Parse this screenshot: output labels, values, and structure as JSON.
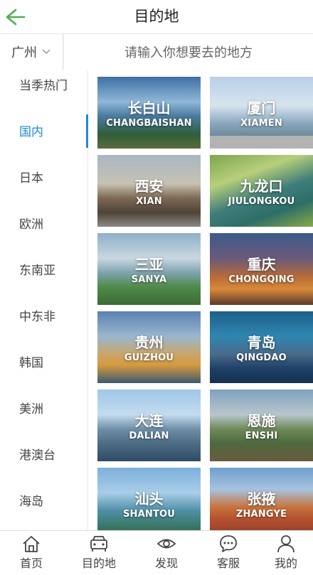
{
  "header": {
    "title": "目的地"
  },
  "search": {
    "city": "广州",
    "placeholder": "请输入你想要去的地方"
  },
  "sidebar": {
    "items": [
      "当季热门",
      "国内",
      "日本",
      "欧洲",
      "东南亚",
      "中东非",
      "韩国",
      "美洲",
      "港澳台",
      "海岛"
    ],
    "active": "国内"
  },
  "destinations": [
    {
      "cn": "长白山",
      "en": "CHANGBAISHAN"
    },
    {
      "cn": "厦门",
      "en": "XIAMEN"
    },
    {
      "cn": "西安",
      "en": "XIAN"
    },
    {
      "cn": "九龙口",
      "en": "JIULONGKOU"
    },
    {
      "cn": "三亚",
      "en": "SANYA"
    },
    {
      "cn": "重庆",
      "en": "CHONGQING"
    },
    {
      "cn": "贵州",
      "en": "GUIZHOU"
    },
    {
      "cn": "青岛",
      "en": "QINGDAO"
    },
    {
      "cn": "大连",
      "en": "DALIAN"
    },
    {
      "cn": "恩施",
      "en": "ENSHI"
    },
    {
      "cn": "汕头",
      "en": "SHANTOU"
    },
    {
      "cn": "张掖",
      "en": "ZHANGYE"
    }
  ],
  "tabs": [
    {
      "label": "首页",
      "icon": "home-icon"
    },
    {
      "label": "目的地",
      "icon": "car-icon"
    },
    {
      "label": "发现",
      "icon": "eye-icon"
    },
    {
      "label": "客服",
      "icon": "chat-icon"
    },
    {
      "label": "我的",
      "icon": "user-icon"
    }
  ],
  "colors": {
    "accent": "#1e8ad6",
    "back_arrow": "#4caf50"
  }
}
